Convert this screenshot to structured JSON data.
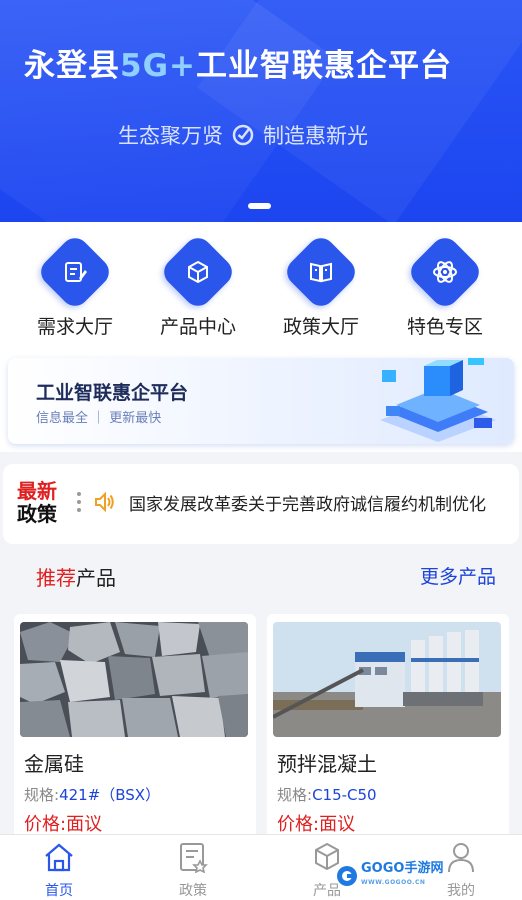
{
  "banner": {
    "title_prefix": "永登县",
    "title_accent": "5G+",
    "title_suffix": "工业智联惠企平台",
    "subtitle_left": "生态聚万贤",
    "subtitle_right": "制造惠新光"
  },
  "categories": [
    {
      "label": "需求大厅",
      "icon": "edit-document-icon"
    },
    {
      "label": "产品中心",
      "icon": "cube-box-icon"
    },
    {
      "label": "政策大厅",
      "icon": "open-book-icon"
    },
    {
      "label": "特色专区",
      "icon": "atom-icon"
    }
  ],
  "promo": {
    "title": "工业智联惠企平台",
    "subtitle": "信息最全 ｜ 更新最快"
  },
  "news": {
    "tag_line1": "最新",
    "tag_line2": "政策",
    "headline": "国家发展改革委关于完善政府诚信履约机制优化"
  },
  "recommend": {
    "title_red": "推荐",
    "title_rest": "产品",
    "more": "更多产品"
  },
  "products": [
    {
      "name": "金属硅",
      "spec_label": "规格:",
      "spec_value": "421#（BSX）",
      "price": "价格:面议"
    },
    {
      "name": "预拌混凝土",
      "spec_label": "规格:",
      "spec_value": "C15-C50",
      "price": "价格:面议"
    }
  ],
  "tabs": [
    {
      "label": "首页",
      "icon": "home-icon",
      "active": true
    },
    {
      "label": "政策",
      "icon": "policy-document-icon",
      "active": false
    },
    {
      "label": "产品",
      "icon": "product-cube-icon",
      "active": false
    },
    {
      "label": "我的",
      "icon": "user-icon",
      "active": false
    }
  ],
  "watermark": {
    "text": "GOGO手游网",
    "small": "WWW.GOGOO.CN"
  },
  "colors": {
    "brand_blue": "#2a56ec",
    "accent_red": "#e02020",
    "link_blue": "#1c44d8"
  }
}
